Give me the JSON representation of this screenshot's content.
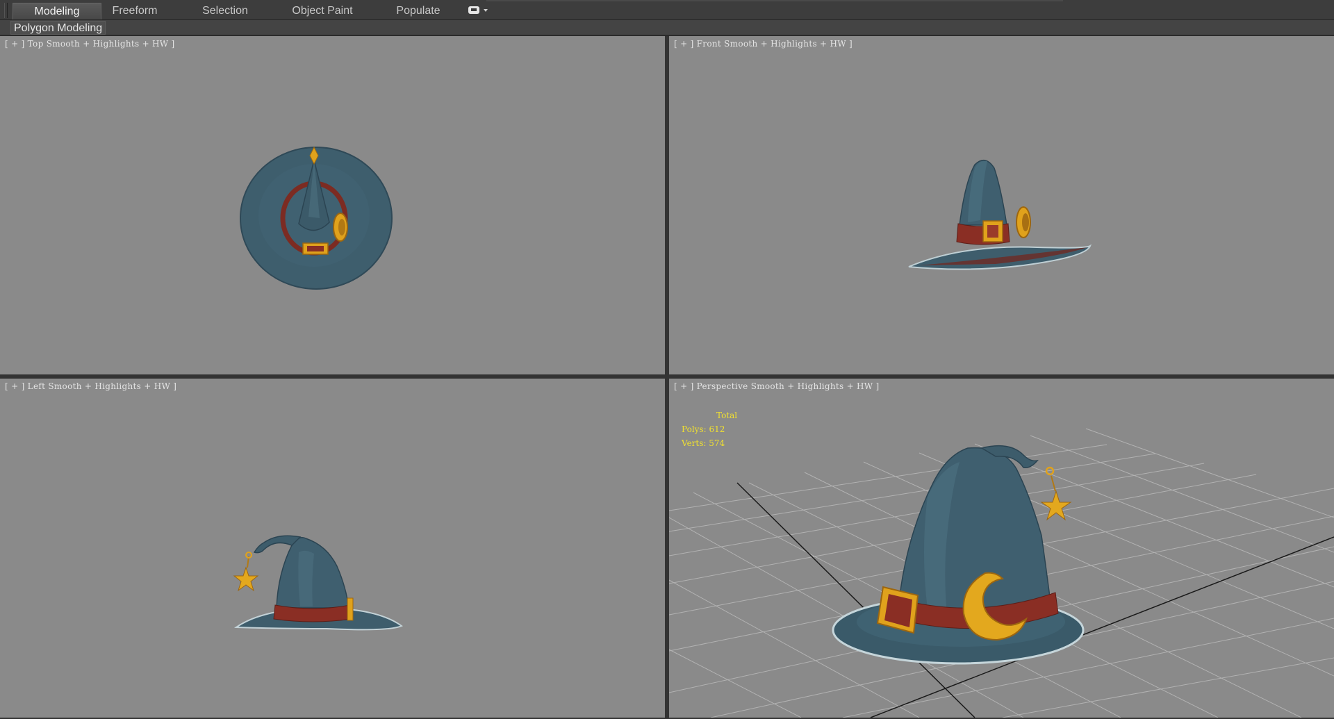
{
  "ribbon": {
    "tabs": [
      {
        "label": "Modeling",
        "active": true
      },
      {
        "label": "Freeform",
        "active": false
      },
      {
        "label": "Selection",
        "active": false
      },
      {
        "label": "Object Paint",
        "active": false
      },
      {
        "label": "Populate",
        "active": false
      }
    ],
    "panel_label": "Polygon Modeling",
    "toggle_icon": "ribbon-minimize-icon"
  },
  "viewports": {
    "top": {
      "b1": "[ + ]",
      "view": "Top",
      "shading": "Smooth + Highlights + HW ]"
    },
    "front": {
      "b1": "[ + ]",
      "view": "Front",
      "shading": "Smooth + Highlights + HW ]"
    },
    "left": {
      "b1": "[ + ]",
      "view": "Left",
      "shading": "Smooth + Highlights + HW ]"
    },
    "perspective": {
      "b1": "[ + ]",
      "view": "Perspective",
      "shading": "Smooth + Highlights + HW ]",
      "stats": {
        "total_label": "Total",
        "polys": "Polys: 612",
        "verts": "Verts: 574"
      }
    }
  },
  "colors": {
    "viewport_bg": "#8a8a8a",
    "hat_blue": "#3f5f6f",
    "band_red": "#8a2e24",
    "gold": "#e0a21c",
    "stats_text": "#f0e030"
  }
}
